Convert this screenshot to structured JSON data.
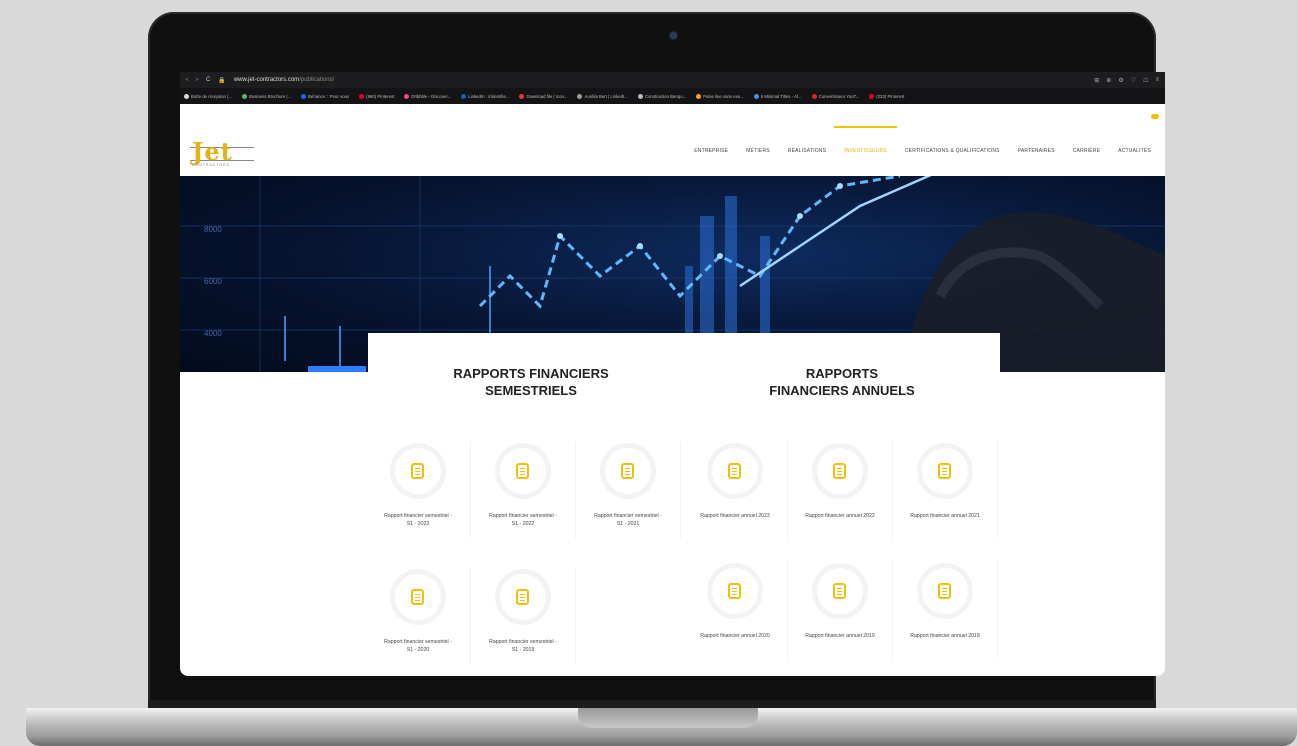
{
  "browser": {
    "url_host": "www.jet-contractors.com",
    "url_path": "/publications/",
    "nav_back": "‹",
    "nav_forward": "›",
    "reload": "C",
    "toolbar_icons": [
      "⊞",
      "⊕",
      "⚙",
      "♡",
      "☖",
      "≡"
    ],
    "bookmarks": [
      {
        "label": "Boîte de réception (...",
        "color": "#d9d9d9"
      },
      {
        "label": "Business Brochure |...",
        "color": "#5cb85c"
      },
      {
        "label": "Behance :: Pour vous",
        "color": "#1769ff"
      },
      {
        "label": "(980) Pinterest",
        "color": "#e60023"
      },
      {
        "label": "Dribbble - Discover...",
        "color": "#ea4c89"
      },
      {
        "label": "LinkedIn : s'identifie...",
        "color": "#0a66c2"
      },
      {
        "label": "Download file | Icon...",
        "color": "#e8392f"
      },
      {
        "label": "Aurélia Bert | LinkedI...",
        "color": "#9c9c9c"
      },
      {
        "label": "Construction Banqu...",
        "color": "#bbbbbb"
      },
      {
        "label": "Pulse line vans exe...",
        "color": "#f5a623"
      },
      {
        "label": "6 Minimal Titles - Af...",
        "color": "#4a90d9"
      },
      {
        "label": "Convertisseur YouT...",
        "color": "#e62117"
      },
      {
        "label": "(233) Pinterest",
        "color": "#e60023"
      }
    ]
  },
  "site": {
    "logo_text": "Jet",
    "logo_sub": "CONTRACTORS",
    "nav": [
      "ENTREPRISE",
      "MÉTIERS",
      "RÉALISATIONS",
      "INVESTISSEURS",
      "CERTIFICATIONS & QUALIFICATIONS",
      "PARTENAIRES",
      "CARRIÈRE",
      "ACTUALITÉS"
    ],
    "active_nav": "INVESTISSEURS"
  },
  "hero": {
    "ticks": [
      "8000",
      "6000",
      "4000"
    ]
  },
  "sections": {
    "semestrial_title_l1": "RAPPORTS FINANCIERS",
    "semestrial_title_l2": "SEMESTRIELS",
    "annual_title_l1": "RAPPORTS",
    "annual_title_l2": "FINANCIERS ANNUELS"
  },
  "semestrial_reports": [
    {
      "l1": "Rapport financier semestriel -",
      "l2": "S1 - 2023"
    },
    {
      "l1": "Rapport financier semestriel -",
      "l2": "S1 - 2022"
    },
    {
      "l1": "Rapport financier semestriel -",
      "l2": "S1 - 2021"
    },
    {
      "l1": "Rapport financier semestriel -",
      "l2": "S1 - 2020"
    },
    {
      "l1": "Rapport financier semestriel -",
      "l2": "S1 - 2019"
    }
  ],
  "annual_reports": [
    {
      "l1": "Rapport financier annuel 2023"
    },
    {
      "l1": "Rapport financier annuel 2022"
    },
    {
      "l1": "Rapport financier annuel 2021"
    },
    {
      "l1": "Rapport financier annuel 2020"
    },
    {
      "l1": "Rapport financier annuel 2019"
    },
    {
      "l1": "Rapport financier annuel 2018"
    }
  ]
}
